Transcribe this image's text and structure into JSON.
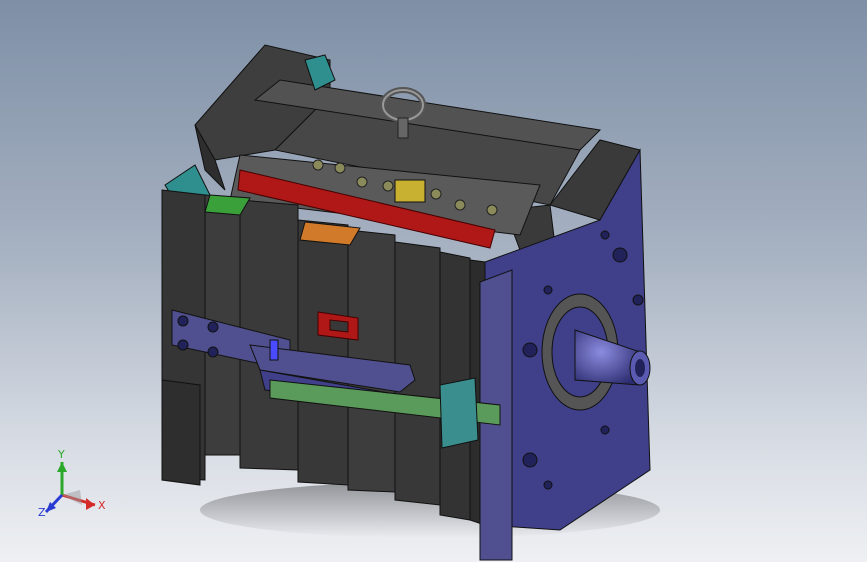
{
  "viewport": {
    "background_top": "#7e8fa6",
    "background_bottom": "#eef0f3"
  },
  "triad": {
    "x_label": "X",
    "y_label": "Y",
    "z_label": "Z",
    "x_color": "#d42a2a",
    "y_color": "#2aa82a",
    "z_color": "#2a3ad4"
  },
  "model": {
    "plate_color": "#3c3c3c",
    "side_plate_color": "#3f3f8a",
    "clamp_color": "#505090",
    "red_bar_color": "#b01818",
    "green_bar_color": "#5a9a5a",
    "cyan_block_color": "#3a8e8e",
    "orange_block_color": "#d07a2a",
    "green_block_color": "#3aa03a",
    "ring_color": "#6a6a6a",
    "nozzle_color": "#4a4aa0"
  }
}
